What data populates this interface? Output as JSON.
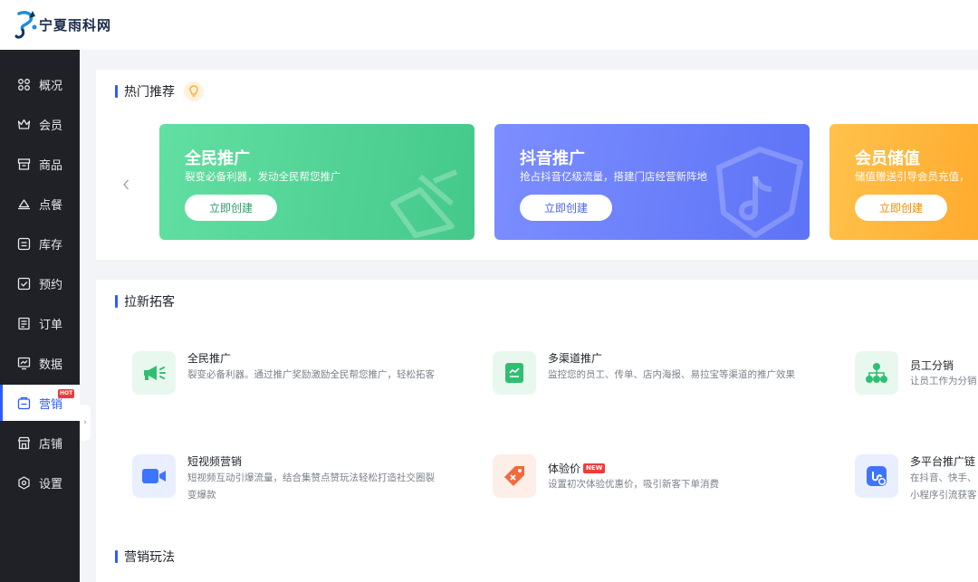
{
  "app": {
    "logo_text": "宁夏雨科网"
  },
  "sidebar": {
    "items": [
      {
        "label": "概况",
        "icon": "grid-icon"
      },
      {
        "label": "会员",
        "icon": "crown-icon"
      },
      {
        "label": "商品",
        "icon": "shop-box-icon"
      },
      {
        "label": "点餐",
        "icon": "dish-cover-icon"
      },
      {
        "label": "库存",
        "icon": "inventory-icon"
      },
      {
        "label": "预约",
        "icon": "calendar-check-icon"
      },
      {
        "label": "订单",
        "icon": "order-list-icon"
      },
      {
        "label": "数据",
        "icon": "chart-screen-icon"
      },
      {
        "label": "营销",
        "icon": "marketing-icon",
        "active": true,
        "badge": "HOT"
      },
      {
        "label": "店铺",
        "icon": "store-icon"
      },
      {
        "label": "设置",
        "icon": "settings-icon"
      }
    ]
  },
  "hot": {
    "title": "热门推荐",
    "cards": [
      {
        "title": "全民推广",
        "desc": "裂变必备利器，发动全民帮您推广",
        "button": "立即创建",
        "color_from": "#5fdc9f",
        "color_to": "#44c98a"
      },
      {
        "title": "抖音推广",
        "desc": "抢占抖音亿级流量，搭建门店经营新阵地",
        "button": "立即创建",
        "color_from": "#7a8cff",
        "color_to": "#5d73f6"
      },
      {
        "title": "会员储值",
        "desc": "储值赠送引导会员充值，",
        "button": "立即创建",
        "color_from": "#ffc14a",
        "color_to": "#ffa726"
      }
    ]
  },
  "acquire": {
    "title": "拉新拓客",
    "items": [
      {
        "name": "全民推广",
        "desc": "裂变必备利器。通过推广奖励激励全民帮您推广，轻松拓客",
        "icon": "megaphone-icon"
      },
      {
        "name": "多渠道推广",
        "desc": "监控您的员工、传单、店内海报、易拉宝等渠道的推广效果",
        "icon": "channel-doc-icon"
      },
      {
        "name": "员工分销",
        "desc": "让员工作为分销",
        "icon": "team-tree-icon"
      },
      {
        "name": "短视频营销",
        "desc": "短视频互动引爆流量，结合集赞点赞玩法轻松打造社交圈裂变爆款",
        "icon": "video-camera-icon"
      },
      {
        "name": "体验价",
        "badge": "NEW",
        "desc": "设置初次体验优惠价，吸引新客下单消费",
        "icon": "price-tag-icon"
      },
      {
        "name": "多平台推广链",
        "desc": "在抖音、快手、小程序引流获客",
        "icon": "link-icon"
      }
    ]
  },
  "play": {
    "title": "营销玩法"
  },
  "colors": {
    "accent": "#2d5bff",
    "sidebar_bg": "#1f2126",
    "hot_badge": "#f23a3a"
  }
}
